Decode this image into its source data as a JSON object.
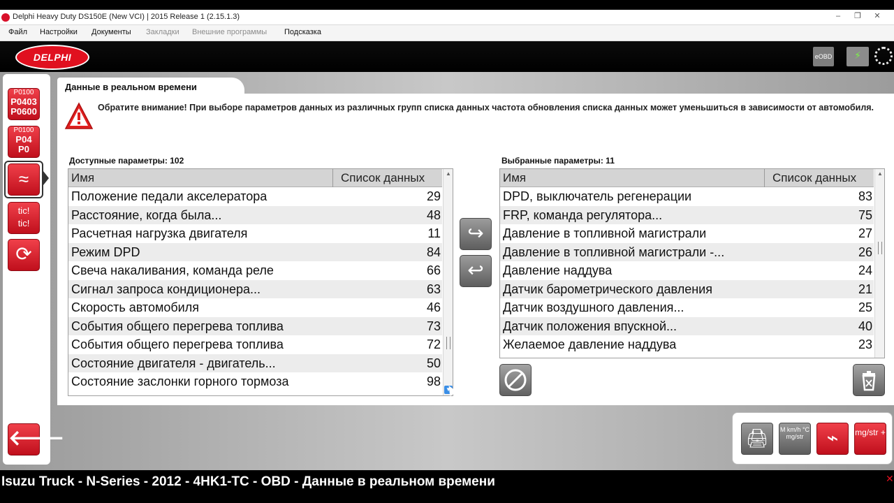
{
  "window": {
    "title": "Delphi Heavy Duty DS150E (New VCI) | 2015 Release 1 (2.15.1.3)",
    "minimize": "‒",
    "maximize": "❐",
    "close": "✕"
  },
  "menu": {
    "items": [
      {
        "label": "Файл",
        "enabled": true
      },
      {
        "label": "Настройки",
        "enabled": true
      },
      {
        "label": "Документы",
        "enabled": true
      },
      {
        "label": "Закладки",
        "enabled": false
      },
      {
        "label": "Внешние программы",
        "enabled": false
      },
      {
        "label": "Подсказка",
        "enabled": true
      }
    ]
  },
  "header": {
    "logo": "DELPHI",
    "eobd": "eOBD",
    "battery_icon": "battery-charge-icon",
    "spinner_icon": "busy-spinner-icon"
  },
  "sidebar": {
    "items": [
      {
        "lines": [
          "P0100",
          "P0403",
          "P0600"
        ],
        "icon": "read-dtc-icon"
      },
      {
        "lines": [
          "P0100",
          "P04",
          "P0"
        ],
        "icon": "clear-dtc-icon"
      },
      {
        "lines": [
          "≈"
        ],
        "icon": "live-data-icon",
        "active": true
      },
      {
        "lines": [
          "tic!",
          "tic!"
        ],
        "icon": "actuator-test-icon"
      },
      {
        "lines": [
          "⟳"
        ],
        "icon": "service-functions-icon"
      }
    ],
    "back": "🡐"
  },
  "tab": {
    "title": "Данные в реальном времени"
  },
  "warning": {
    "text": "Обратите внимание!  При выборе параметров данных из различных групп списка данных частота обновления списка данных может уменьшиться в зависимости от автомобиля."
  },
  "available": {
    "label": "Доступные параметры: 102",
    "col_name": "Имя",
    "col_list": "Список данных",
    "rows": [
      {
        "name": "Положение педали акселератора",
        "list": "29"
      },
      {
        "name": "Расстояние,  когда была...",
        "list": "48"
      },
      {
        "name": "Расчетная нагрузка двигателя",
        "list": "11"
      },
      {
        "name": "Режим DPD",
        "list": "84"
      },
      {
        "name": "Свеча накаливания, команда реле",
        "list": "66"
      },
      {
        "name": "Сигнал  запроса  кондиционера...",
        "list": "63"
      },
      {
        "name": "Скорость автомобиля",
        "list": "46"
      },
      {
        "name": "События общего перегрева топлива",
        "list": "73"
      },
      {
        "name": "События общего перегрева топлива",
        "list": "72"
      },
      {
        "name": "Состояние  двигателя  -  двигатель...",
        "list": "50"
      },
      {
        "name": "Состояние заслонки горного тормоза",
        "list": "98"
      }
    ]
  },
  "selected": {
    "label": "Выбранные параметры: 11",
    "col_name": "Имя",
    "col_list": "Список данных",
    "rows": [
      {
        "name": "DPD, выключатель регенерации",
        "list": "83"
      },
      {
        "name": "FRP,  команда  регулятора...",
        "list": "75"
      },
      {
        "name": "Давление в топливной магистрали",
        "list": "27"
      },
      {
        "name": "Давление  в  топливной  магистрали  -...",
        "list": "26"
      },
      {
        "name": "Давление наддува",
        "list": "24"
      },
      {
        "name": "Датчик барометрического давления",
        "list": "21"
      },
      {
        "name": "Датчик  воздушного  давления...",
        "list": "25"
      },
      {
        "name": "Датчик  положения  впускной...",
        "list": "40"
      },
      {
        "name": "Желаемое давление наддува",
        "list": "23"
      }
    ]
  },
  "buttons": {
    "add": "↪",
    "remove": "↩",
    "reset_icon": "no-flight-icon",
    "delete_icon": "trash-icon"
  },
  "tools": [
    {
      "icon": "print-icon",
      "label": "🖨",
      "style": "grey"
    },
    {
      "icon": "units-icon",
      "label": "M km/h °C mg/str",
      "style": "grey"
    },
    {
      "icon": "graph-icon",
      "label": "⌁",
      "style": "red"
    },
    {
      "icon": "record-icon",
      "label": "mg/str +",
      "style": "red"
    }
  ],
  "footer": {
    "text": "Isuzu Truck - N-Series - 2012 - 4HK1-TC - OBD - Данные в реальном времени",
    "close": "✕"
  }
}
